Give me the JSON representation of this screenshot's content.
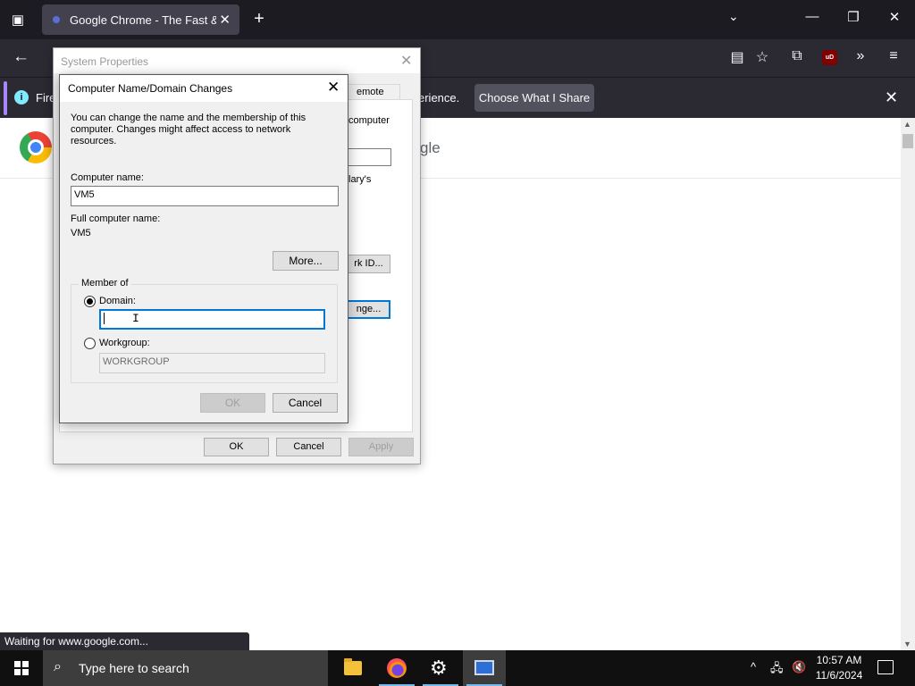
{
  "browser": {
    "tab_title": "Google Chrome - The Fast & Se",
    "tab_close": "✕",
    "new_tab": "+",
    "tabs_menu": "⌄",
    "window_controls": {
      "minimize": "—",
      "maximize": "❐",
      "close": "✕"
    },
    "nav": {
      "back": "←",
      "ublock_label": "uD"
    },
    "notification": {
      "text_left": "Fire",
      "text_right": "erience.",
      "button": "Choose What I Share",
      "close": "✕"
    },
    "status_text": "Waiting for www.google.com..."
  },
  "page": {
    "google_text": "gle"
  },
  "system_properties": {
    "title": "System Properties",
    "close": "✕",
    "tab_partial": "emote",
    "text_computer": "computer",
    "text_lary": "lary's",
    "network_id_button": "rk ID...",
    "change_button": "nge...",
    "ok_button": "OK",
    "cancel_button": "Cancel",
    "apply_button": "Apply"
  },
  "computer_name_dialog": {
    "title": "Computer Name/Domain Changes",
    "close": "✕",
    "description": "You can change the name and the membership of this computer. Changes might affect access to network resources.",
    "computer_name_label": "Computer name:",
    "computer_name_value": "VM5",
    "full_name_label": "Full computer name:",
    "full_name_value": "VM5",
    "more_button": "More...",
    "member_of_label": "Member of",
    "domain_label": "Domain:",
    "domain_value": "",
    "workgroup_label": "Workgroup:",
    "workgroup_placeholder": "WORKGROUP",
    "ok_button": "OK",
    "cancel_button": "Cancel",
    "selected_membership": "domain"
  },
  "taskbar": {
    "search_placeholder": "Type here to search",
    "apps": [
      "file-explorer",
      "firefox",
      "settings",
      "system-properties"
    ],
    "tray": {
      "chevron": "^",
      "network": "🖧",
      "volume": "🔇"
    },
    "time": "10:57 AM",
    "date": "11/6/2024"
  },
  "colors": {
    "titlebar_dark": "#1c1b22",
    "toolbar": "#2b2a33",
    "accent": "#0078d7",
    "taskbar": "#101010"
  }
}
